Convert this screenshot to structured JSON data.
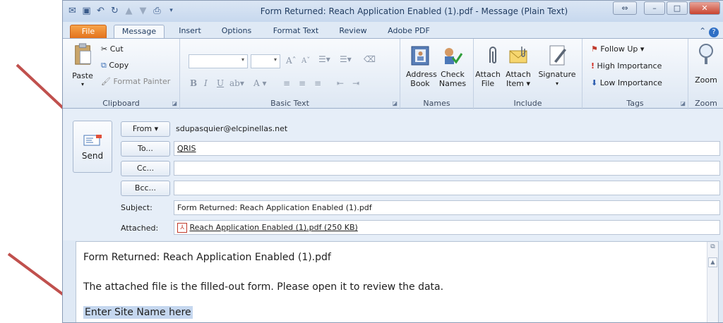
{
  "window": {
    "title": "Form Returned: Reach Application Enabled (1).pdf  -  Message (Plain Text)"
  },
  "tabs": [
    "File",
    "Message",
    "Insert",
    "Options",
    "Format Text",
    "Review",
    "Adobe PDF"
  ],
  "ribbon": {
    "clipboard": {
      "paste": "Paste",
      "cut": "Cut",
      "copy": "Copy",
      "format_painter": "Format Painter",
      "label": "Clipboard"
    },
    "basic_text": {
      "label": "Basic Text"
    },
    "names": {
      "address_book_1": "Address",
      "address_book_2": "Book",
      "check_names_1": "Check",
      "check_names_2": "Names",
      "label": "Names"
    },
    "include": {
      "attach_file_1": "Attach",
      "attach_file_2": "File",
      "attach_item_1": "Attach",
      "attach_item_2": "Item ▾",
      "signature": "Signature",
      "label": "Include"
    },
    "tags": {
      "follow_up": "Follow Up ▾",
      "high_importance": "High Importance",
      "low_importance": "Low Importance",
      "label": "Tags"
    },
    "zoom": {
      "zoom": "Zoom",
      "label": "Zoom"
    }
  },
  "header": {
    "send": "Send",
    "from_button": "From ▾",
    "from_value": "sdupasquier@elcpinellas.net",
    "to_button": "To...",
    "to_value": "QRIS",
    "cc_button": "Cc...",
    "cc_value": "",
    "bcc_button": "Bcc...",
    "bcc_value": "",
    "subject_label": "Subject:",
    "subject_value": "Form Returned: Reach Application Enabled (1).pdf",
    "attached_label": "Attached:",
    "attachment": "Reach Application Enabled (1).pdf (250 KB)"
  },
  "body": {
    "line1": "Form Returned: Reach Application Enabled (1).pdf",
    "line2": "The attached file is the filled-out form. Please open it to review the data.",
    "line3": "Enter Site Name here"
  },
  "colors": {
    "annotation_arrow": "#c0504d",
    "file_tab": "#e3721c"
  }
}
